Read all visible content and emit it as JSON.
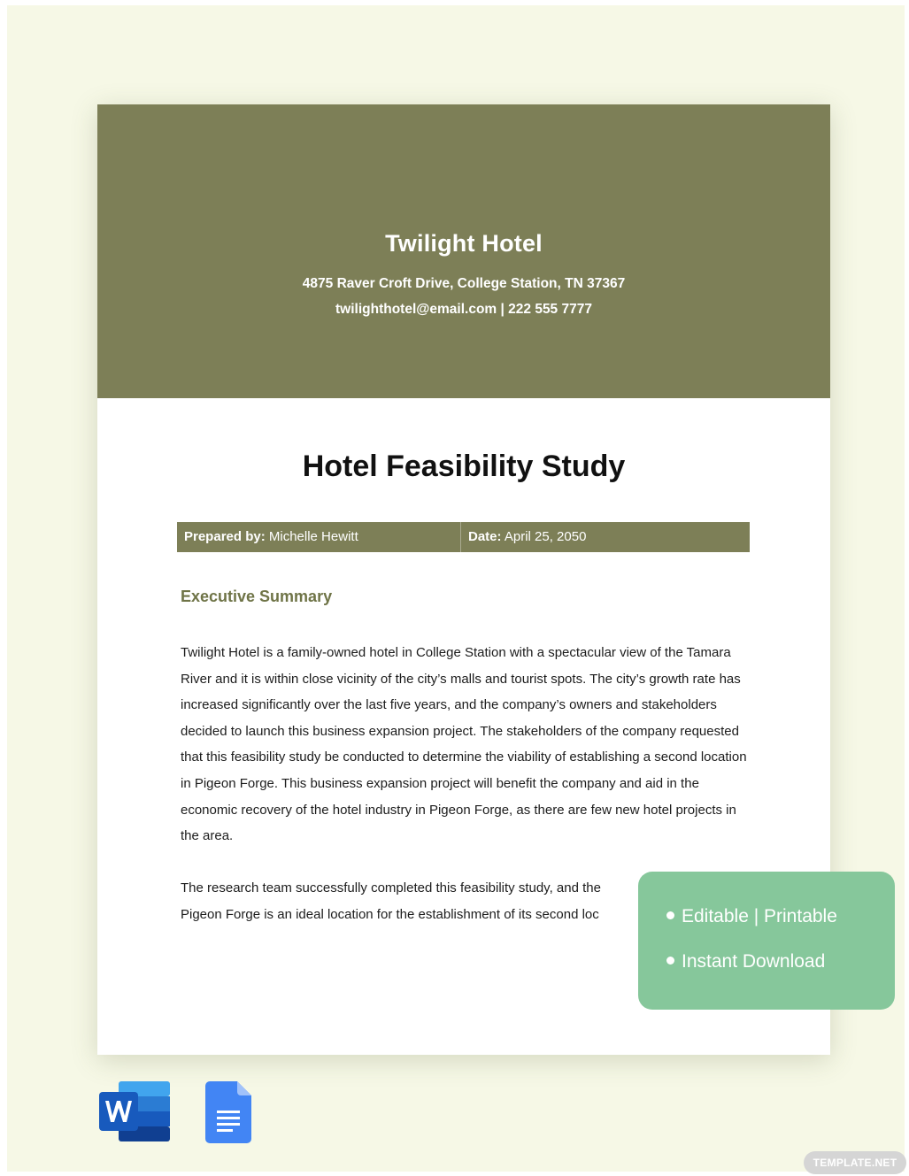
{
  "header": {
    "hotel_name": "Twilight Hotel",
    "address": "4875 Raver Croft Drive, College Station, TN 37367",
    "contact": "twilighthotel@email.com | 222 555 7777"
  },
  "document": {
    "title": "Hotel Feasibility Study",
    "prepared_by_label": "Prepared by:",
    "prepared_by_value": "Michelle Hewitt",
    "date_label": "Date:",
    "date_value": "April 25, 2050"
  },
  "executive_summary": {
    "heading": "Executive Summary",
    "paragraph1": "Twilight Hotel is a family-owned hotel in College Station with a spectacular view of the Tamara River and it is within close vicinity of the city’s malls and tourist spots. The city’s growth rate has increased significantly over the last five years, and the company’s owners and stakeholders decided to launch this business expansion project. The stakeholders of the company requested that this feasibility study be conducted to determine the viability of establishing a second location in Pigeon Forge. This business expansion project will benefit the company and aid in the economic recovery of the hotel industry in Pigeon Forge, as there are few new hotel projects in the area.",
    "paragraph2_line1": "The research team successfully completed this feasibility study, and the",
    "paragraph2_line2": "Pigeon Forge is an ideal location for the establishment of its second loc"
  },
  "badge": {
    "line1": "Editable | Printable",
    "line2": "Instant Download"
  },
  "icons": {
    "word": "word-icon",
    "docs": "google-docs-icon"
  },
  "watermark": "TEMPLATE.NET",
  "colors": {
    "header_bg": "#7d7f57",
    "page_bg": "#f6f8e6",
    "heading_green": "#6f7447",
    "badge_bg": "#86c79b"
  }
}
